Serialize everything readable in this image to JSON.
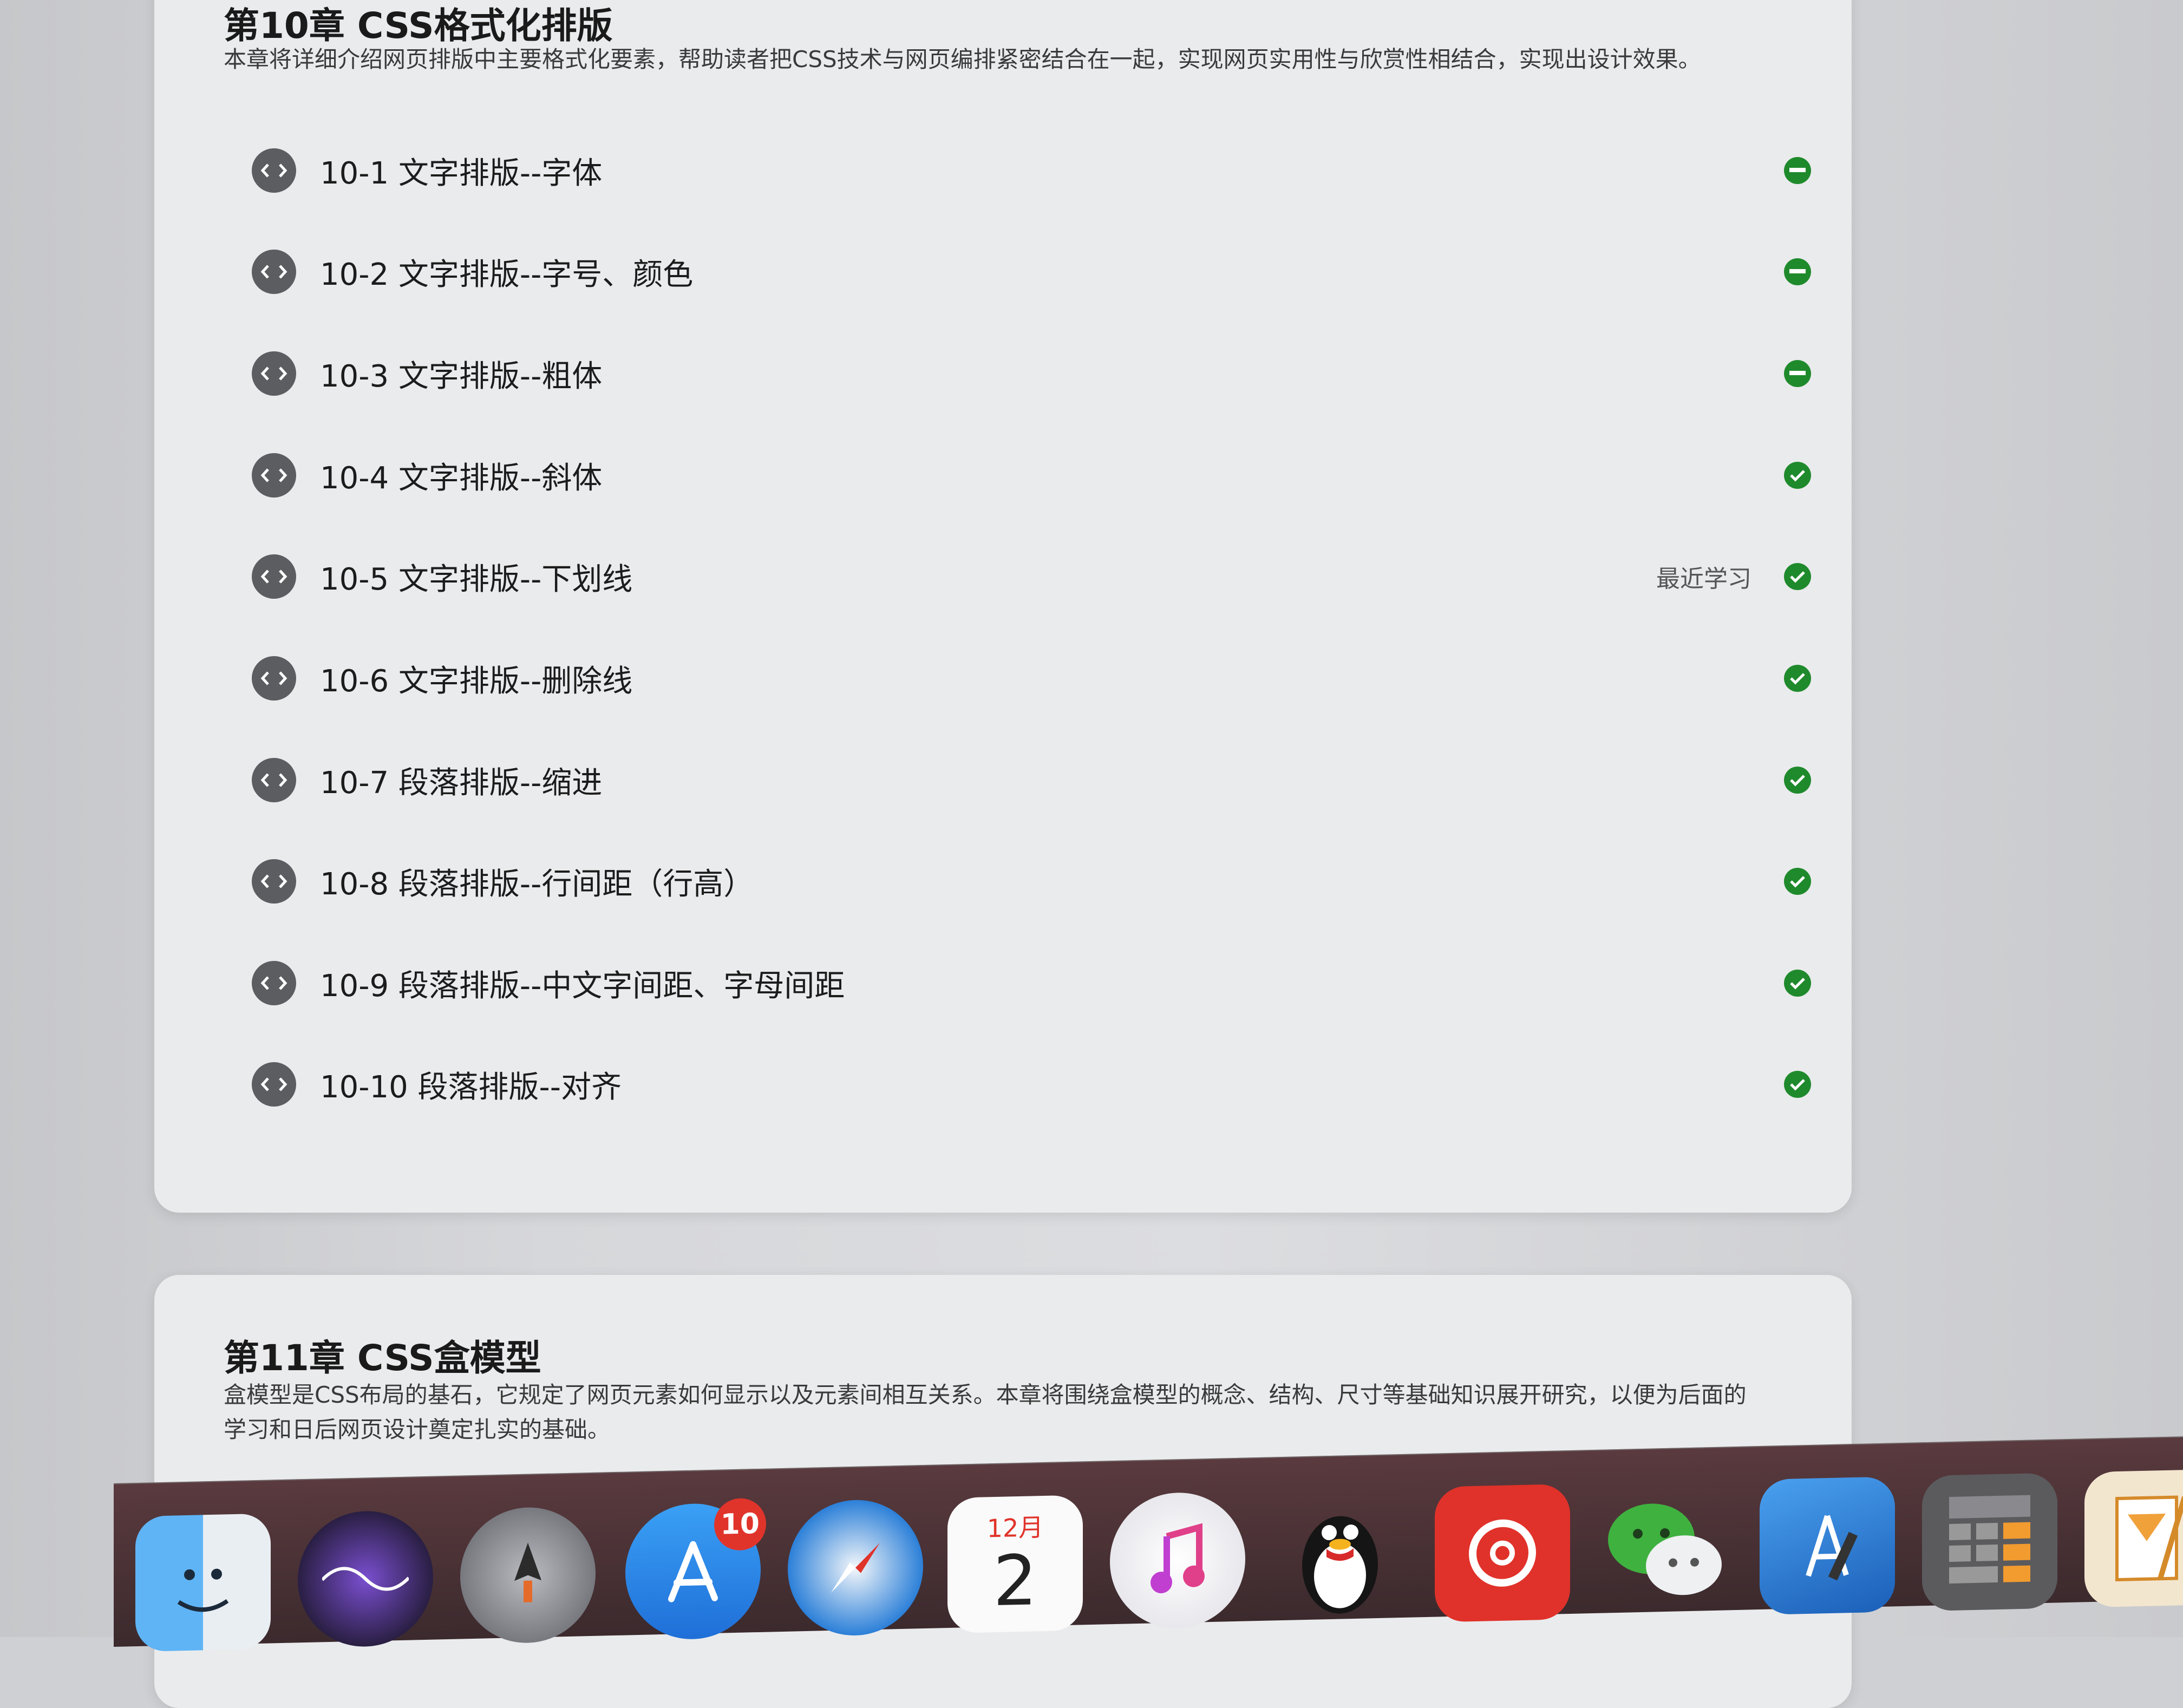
{
  "chapters": [
    {
      "title": "第10章 CSS格式化排版",
      "description": "本章将详细介绍网页排版中主要格式化要素，帮助读者把CSS技术与网页编排紧密结合在一起，实现网页实用性与欣赏性相结合，实现出设计效果。",
      "lessons": [
        {
          "title": "10-1 文字排版--字体",
          "status": "in-progress",
          "recent": ""
        },
        {
          "title": "10-2 文字排版--字号、颜色",
          "status": "in-progress",
          "recent": ""
        },
        {
          "title": "10-3 文字排版--粗体",
          "status": "in-progress",
          "recent": ""
        },
        {
          "title": "10-4 文字排版--斜体",
          "status": "completed",
          "recent": ""
        },
        {
          "title": "10-5 文字排版--下划线",
          "status": "completed",
          "recent": "最近学习"
        },
        {
          "title": "10-6 文字排版--删除线",
          "status": "completed",
          "recent": ""
        },
        {
          "title": "10-7 段落排版--缩进",
          "status": "completed",
          "recent": ""
        },
        {
          "title": "10-8 段落排版--行间距（行高）",
          "status": "completed",
          "recent": ""
        },
        {
          "title": "10-9 段落排版--中文字间距、字母间距",
          "status": "completed",
          "recent": ""
        },
        {
          "title": "10-10 段落排版--对齐",
          "status": "completed",
          "recent": ""
        }
      ]
    },
    {
      "title": "第11章 CSS盒模型",
      "description": "盒模型是CSS布局的基石，它规定了网页元素如何显示以及元素间相互关系。本章将围绕盒模型的概念、结构、尺寸等基础知识展开研究，以便为后面的学习和日后网页设计奠定扎实的基础。"
    }
  ],
  "dock": {
    "apps": [
      {
        "name": "Finder",
        "icon": "finder-icon",
        "color": "#4aa3f0"
      },
      {
        "name": "Siri",
        "icon": "siri-icon",
        "color": "#3c2b58"
      },
      {
        "name": "Launchpad",
        "icon": "launchpad-icon",
        "color": "#8e9096"
      },
      {
        "name": "App Store",
        "icon": "app-store-icon",
        "color": "#2d8cf0",
        "badge": "10"
      },
      {
        "name": "Safari",
        "icon": "safari-icon",
        "color": "#e8eef5"
      },
      {
        "name": "Calendar",
        "icon": "calendar-icon",
        "color": "#ffffff",
        "month": "12月",
        "day": "2"
      },
      {
        "name": "iTunes",
        "icon": "music-note-icon",
        "color": "#f2f2f4"
      },
      {
        "name": "QQ",
        "icon": "qq-penguin-icon",
        "color": "#2b2b2b"
      },
      {
        "name": "NetEase Cloud Music",
        "icon": "netease-music-icon",
        "color": "#e0322a"
      },
      {
        "name": "WeChat",
        "icon": "wechat-icon",
        "color": "#4bbd4b"
      },
      {
        "name": "Xcode",
        "icon": "xcode-icon",
        "color": "#2f7fd8"
      },
      {
        "name": "Calculator",
        "icon": "calculator-icon",
        "color": "#6b6b6b"
      },
      {
        "name": "Pages",
        "icon": "pages-icon",
        "color": "#f0a13a"
      }
    ]
  },
  "colors": {
    "completed": "#1f8a2c",
    "accent_badge": "#e0342b"
  }
}
